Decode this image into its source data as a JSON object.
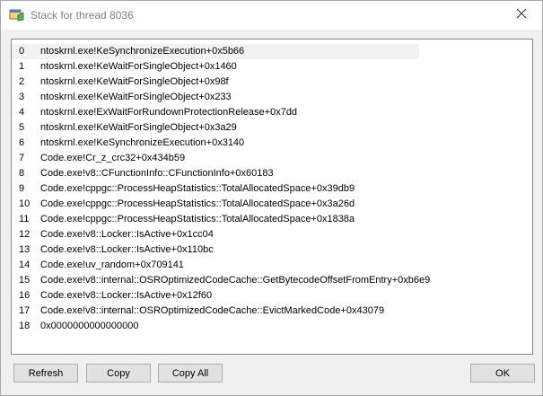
{
  "window": {
    "title": "Stack for thread 8036"
  },
  "stack": {
    "frames": [
      {
        "index": "0",
        "text": "ntoskrnl.exe!KeSynchronizeExecution+0x5b66"
      },
      {
        "index": "1",
        "text": "ntoskrnl.exe!KeWaitForSingleObject+0x1460"
      },
      {
        "index": "2",
        "text": "ntoskrnl.exe!KeWaitForSingleObject+0x98f"
      },
      {
        "index": "3",
        "text": "ntoskrnl.exe!KeWaitForSingleObject+0x233"
      },
      {
        "index": "4",
        "text": "ntoskrnl.exe!ExWaitForRundownProtectionRelease+0x7dd"
      },
      {
        "index": "5",
        "text": "ntoskrnl.exe!KeWaitForSingleObject+0x3a29"
      },
      {
        "index": "6",
        "text": "ntoskrnl.exe!KeSynchronizeExecution+0x3140"
      },
      {
        "index": "7",
        "text": "Code.exe!Cr_z_crc32+0x434b59"
      },
      {
        "index": "8",
        "text": "Code.exe!v8::CFunctionInfo::CFunctionInfo+0x60183"
      },
      {
        "index": "9",
        "text": "Code.exe!cppgc::ProcessHeapStatistics::TotalAllocatedSpace+0x39db9"
      },
      {
        "index": "10",
        "text": "Code.exe!cppgc::ProcessHeapStatistics::TotalAllocatedSpace+0x3a26d"
      },
      {
        "index": "11",
        "text": "Code.exe!cppgc::ProcessHeapStatistics::TotalAllocatedSpace+0x1838a"
      },
      {
        "index": "12",
        "text": "Code.exe!v8::Locker::IsActive+0x1cc04"
      },
      {
        "index": "13",
        "text": "Code.exe!v8::Locker::IsActive+0x110bc"
      },
      {
        "index": "14",
        "text": "Code.exe!uv_random+0x709141"
      },
      {
        "index": "15",
        "text": "Code.exe!v8::internal::OSROptimizedCodeCache::GetBytecodeOffsetFromEntry+0xb6e9"
      },
      {
        "index": "16",
        "text": "Code.exe!v8::Locker::IsActive+0x12f60"
      },
      {
        "index": "17",
        "text": "Code.exe!v8::internal::OSROptimizedCodeCache::EvictMarkedCode+0x43079"
      },
      {
        "index": "18",
        "text": "0x0000000000000000"
      }
    ],
    "selected_index": 0
  },
  "buttons": {
    "refresh": "Refresh",
    "copy": "Copy",
    "copy_all": "Copy All",
    "ok": "OK"
  },
  "icons": {
    "app": "app-window-icon",
    "close": "close-icon"
  }
}
